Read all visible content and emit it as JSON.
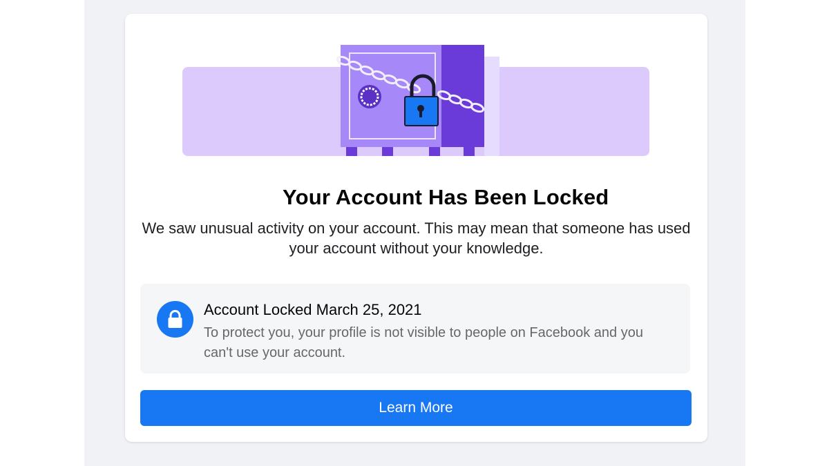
{
  "colors": {
    "page_background": "#f0f2f5",
    "card_background": "#ffffff",
    "primary_blue": "#1877f2",
    "illustration_purple_light": "#dccafd",
    "illustration_purple": "#a788f9",
    "illustration_purple_dark": "#6a3bd8"
  },
  "illustration": {
    "icon": "locked-safe-icon"
  },
  "dialog": {
    "title": "Your Account Has Been Locked",
    "description": "We saw unusual activity on your account. This may mean that someone has used your account without your knowledge."
  },
  "info_box": {
    "icon": "lock-icon",
    "title": "Account Locked March 25, 2021",
    "text": "To protect you, your profile is not visible to people on Facebook and you can't use your account."
  },
  "actions": {
    "learn_more_label": "Learn More"
  }
}
